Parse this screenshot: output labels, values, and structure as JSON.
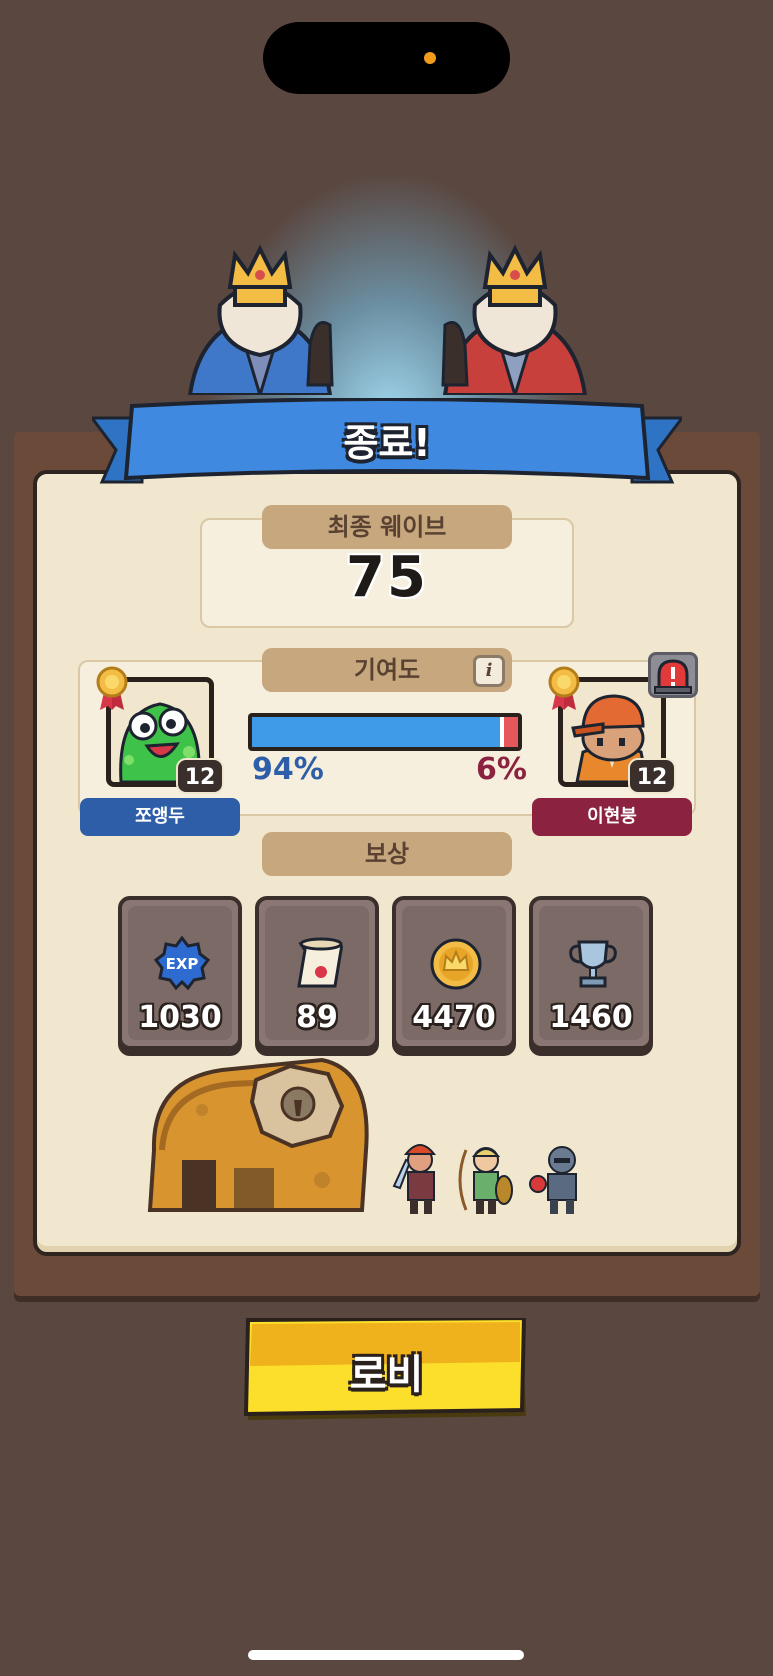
{
  "header": {
    "title": "종료!"
  },
  "final_wave": {
    "label": "최종 웨이브",
    "value": "75"
  },
  "contribution": {
    "label": "기여도",
    "info_icon": "i",
    "left_percent_text": "94%",
    "right_percent_text": "6%",
    "left_share": 0.94,
    "colors": {
      "left": "#3f9be8",
      "right": "#e5575a"
    }
  },
  "players": {
    "left": {
      "name": "쪼앵두",
      "level": "12",
      "plate_color": "#2e5ea8",
      "avatar": "green-slime-icon"
    },
    "right": {
      "name": "이현붕",
      "level": "12",
      "plate_color": "#8b2240",
      "avatar": "orange-cap-character-icon"
    }
  },
  "rewards": {
    "label": "보상",
    "items": [
      {
        "icon": "exp-badge-icon",
        "icon_text": "EXP",
        "value": "1030"
      },
      {
        "icon": "scroll-icon",
        "value": "89"
      },
      {
        "icon": "gold-coin-icon",
        "value": "4470"
      },
      {
        "icon": "trophy-icon",
        "value": "1460"
      }
    ]
  },
  "lobby_button": {
    "label": "로비"
  }
}
